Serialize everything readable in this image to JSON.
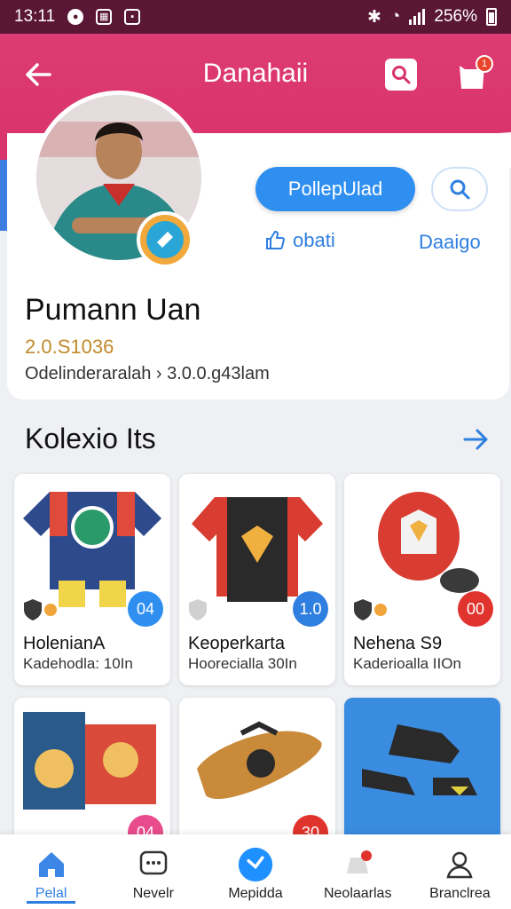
{
  "status_bar": {
    "time": "13:11",
    "battery": "256%"
  },
  "header": {
    "title": "Danahaii"
  },
  "profile": {
    "follow_label": "PollepUlad",
    "like_label": "obati",
    "detail_label": "Daaigo",
    "name": "Pumann Uan",
    "amount": "2.0.S1036",
    "subtitle": "Odelinderaralah › 3.0.0.g43lam"
  },
  "section": {
    "title": "Kolexio Its"
  },
  "items": [
    {
      "name": "HolenianA",
      "sub": "Kadehodla: 10In",
      "price": "04",
      "color": "#2f8ff0"
    },
    {
      "name": "Keoperkarta",
      "sub": "Hoorecialla 30In",
      "price": "1.0",
      "color": "#2f7fe0"
    },
    {
      "name": "Nehena S9",
      "sub": "Kaderioalla IIOn",
      "price": "00",
      "color": "#e0332e"
    },
    {
      "name": "",
      "sub": "",
      "price": "04",
      "color": "#e94c8c"
    },
    {
      "name": "",
      "sub": "",
      "price": "30",
      "color": "#e0332e"
    },
    {
      "name": "",
      "sub": "",
      "price": "",
      "color": "#2f8ff0"
    }
  ],
  "nav": [
    {
      "label": "Pelal",
      "icon": "home-icon"
    },
    {
      "label": "Nevelr",
      "icon": "chat-icon"
    },
    {
      "label": "Mepidda",
      "icon": "send-icon"
    },
    {
      "label": "Neolaarlas",
      "icon": "notification-icon"
    },
    {
      "label": "Branclrea",
      "icon": "profile-icon"
    }
  ],
  "colors": {
    "header": "#dc3a70",
    "accent": "#2f7fe0",
    "gold": "#c08a2a"
  }
}
